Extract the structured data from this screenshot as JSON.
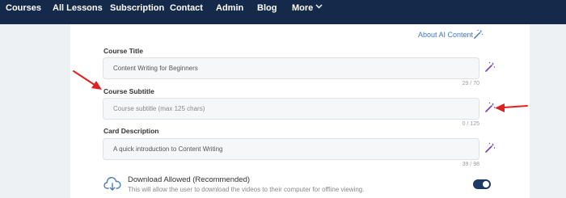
{
  "nav": {
    "items": [
      {
        "label": "Courses"
      },
      {
        "label": "All Lessons"
      },
      {
        "label": "Subscription"
      },
      {
        "label": "Contact"
      },
      {
        "label": "Admin"
      },
      {
        "label": "Blog"
      },
      {
        "label": "More"
      }
    ]
  },
  "about": {
    "label": "About AI Content",
    "icon": "magic-wand-icon"
  },
  "fields": {
    "title": {
      "label": "Course Title",
      "value": "Content Writing for Beginners",
      "counter": "29 / 70"
    },
    "subtitle": {
      "label": "Course Subtitle",
      "placeholder": "Course subtitle (max 125 chars)",
      "counter": "0 / 125"
    },
    "description": {
      "label": "Card Description",
      "value": "A quick introduction to Content Writing",
      "counter": "39 / 98"
    }
  },
  "download": {
    "title": "Download Allowed (Recommended)",
    "description": "This will allow the user to download the videos to their computer for offline viewing.",
    "enabled": true,
    "icon": "cloud-download-icon"
  },
  "colors": {
    "nav_bg": "#152a4a",
    "accent": "#3c78c8",
    "toggle_on": "#1c3a64",
    "wand": "#7a3fb5",
    "annotation_arrow": "#e02020"
  }
}
